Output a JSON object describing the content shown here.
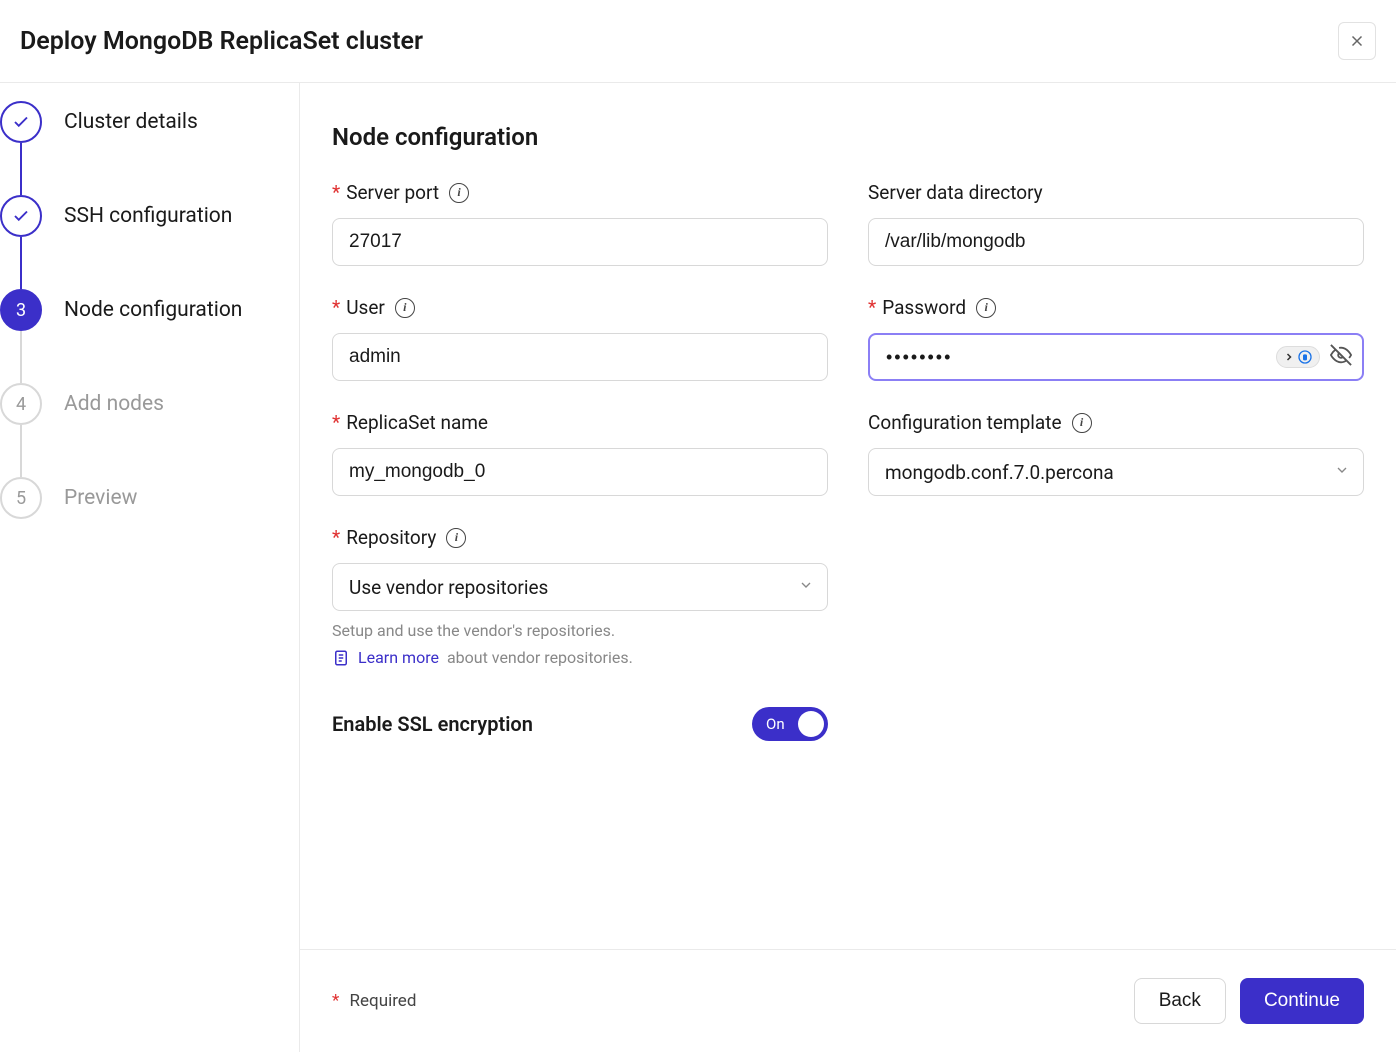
{
  "modal": {
    "title": "Deploy MongoDB ReplicaSet cluster"
  },
  "steps": [
    {
      "label": "Cluster details",
      "status": "completed"
    },
    {
      "label": "SSH configuration",
      "status": "completed"
    },
    {
      "label": "Node configuration",
      "status": "active",
      "number": "3"
    },
    {
      "label": "Add nodes",
      "status": "pending",
      "number": "4"
    },
    {
      "label": "Preview",
      "status": "pending",
      "number": "5"
    }
  ],
  "section": {
    "title": "Node configuration"
  },
  "fields": {
    "server_port": {
      "label": "Server port",
      "value": "27017",
      "required": true,
      "info": true
    },
    "server_data_dir": {
      "label": "Server data directory",
      "value": "/var/lib/mongodb",
      "required": false,
      "info": false
    },
    "user": {
      "label": "User",
      "value": "admin",
      "required": true,
      "info": true
    },
    "password": {
      "label": "Password",
      "value": "••••••••",
      "required": true,
      "info": true
    },
    "replicaset_name": {
      "label": "ReplicaSet name",
      "value": "my_mongodb_0",
      "required": true,
      "info": false
    },
    "config_template": {
      "label": "Configuration template",
      "value": "mongodb.conf.7.0.percona",
      "required": false,
      "info": true
    },
    "repository": {
      "label": "Repository",
      "value": "Use vendor repositories",
      "required": true,
      "info": true,
      "help": "Setup and use the vendor's repositories.",
      "learn_more": "Learn more",
      "learn_more_rest": "about vendor repositories."
    }
  },
  "ssl": {
    "label": "Enable SSL encryption",
    "toggle_label": "On",
    "enabled": true
  },
  "footer": {
    "required_label": "Required",
    "back": "Back",
    "continue": "Continue"
  }
}
